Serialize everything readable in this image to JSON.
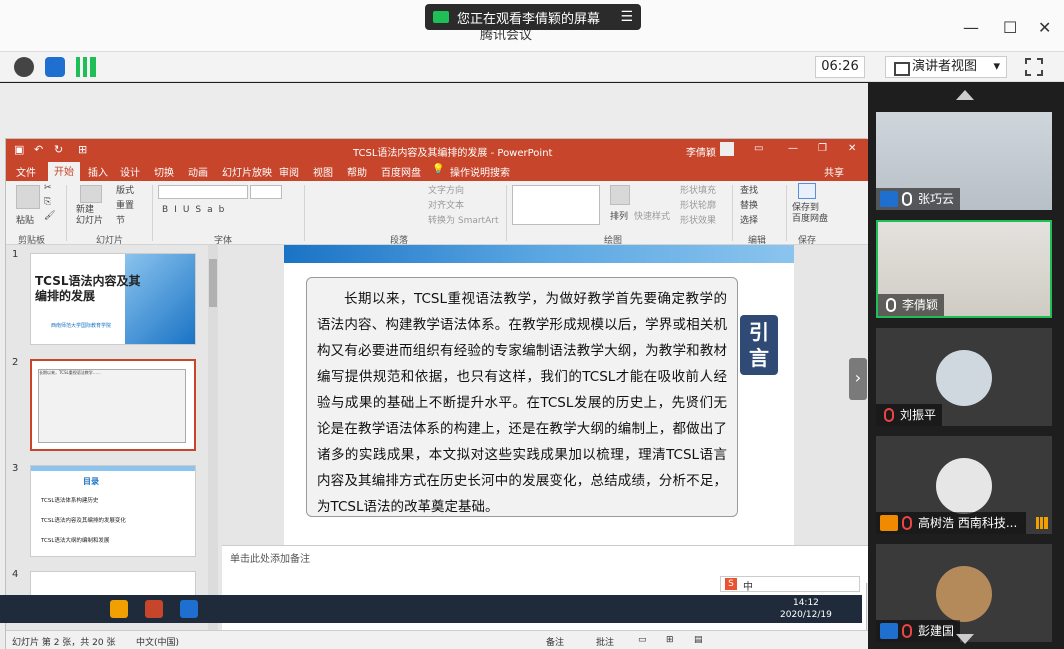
{
  "app": {
    "title": "腾讯会议",
    "share_banner": "您正在观看李倩颖的屏幕",
    "menu_icon": "menu-icon"
  },
  "toolbar": {
    "timer": "06:26",
    "view_mode": "演讲者视图"
  },
  "ppt": {
    "title": "TCSL语法内容及其编排的发展 - PowerPoint",
    "user": "李倩颖",
    "tabs": [
      "文件",
      "开始",
      "插入",
      "设计",
      "切换",
      "动画",
      "幻灯片放映",
      "审阅",
      "视图",
      "帮助",
      "百度网盘",
      "操作说明搜索"
    ],
    "active_tab": "开始",
    "share_label": "共享",
    "ribbon": {
      "paste": "粘贴",
      "clipboard": "剪贴板",
      "new_slide": "新建\n幻灯片",
      "layout": "版式",
      "reset": "重置",
      "section": "节",
      "slides_group": "幻灯片",
      "font_group": "字体",
      "text_direction": "文字方向",
      "align_text": "对齐文本",
      "smartart": "转换为 SmartArt",
      "paragraph_group": "段落",
      "arrange": "排列",
      "quick_styles": "快速样式",
      "shape_fill": "形状填充",
      "shape_outline": "形状轮廓",
      "shape_effects": "形状效果",
      "drawing_group": "绘图",
      "find": "查找",
      "replace": "替换",
      "select": "选择",
      "editing_group": "编辑",
      "save_baidu": "保存到\n百度网盘",
      "save_group": "保存"
    },
    "thumbnails": [
      {
        "num": "1",
        "title": "TCSL语法内容及其编排的发展",
        "sub": "西南师范大学国际教育学院"
      },
      {
        "num": "2",
        "title": "长期以来，TCSL重视语法教学……"
      },
      {
        "num": "3",
        "title": "目录",
        "items": [
          "TCSL语法体系构建历史",
          "TCSL语法内容及其编排的发展变化",
          "TCSL语法大纲的编制和发展"
        ]
      },
      {
        "num": "4"
      }
    ],
    "slide": {
      "body": "长期以来，TCSL重视语法教学，为做好教学首先要确定教学的语法内容、构建教学语法体系。在教学形成规模以后，学界或相关机构又有必要进而组织有经验的专家编制语法教学大纲，为教学和教材编写提供规范和依据，也只有这样，我们的TCSL才能在吸收前人经验与成果的基础上不断提升水平。在TCSL发展的历史上，先贤们无论是在教学语法体系的构建上，还是在教学大纲的编制上，都做出了诸多的实践成果，本文拟对这些实践成果加以梳理，理清TCSL语言内容及其编排方式在历史长河中的发展变化，总结成绩，分析不足，为TCSL语法的改革奠定基础。",
      "badge": "引\n言"
    },
    "notes_placeholder": "单击此处添加备注",
    "status": {
      "slide_info": "幻灯片 第 2 张，共 20 张",
      "language": "中文(中国)",
      "notes": "备注",
      "comments": "批注"
    }
  },
  "taskbar": {
    "time": "14:12",
    "date": "2020/12/19"
  },
  "ime": {
    "label": "中"
  },
  "participants": [
    {
      "name": "张巧云",
      "mic": "on",
      "badge": "user"
    },
    {
      "name": "李倩颖",
      "mic": "on",
      "badge": "none",
      "active": true
    },
    {
      "name": "刘振平",
      "mic": "muted",
      "badge": "none"
    },
    {
      "name": "高树浩 西南科技...",
      "mic": "muted",
      "badge": "orange"
    },
    {
      "name": "彭建国",
      "mic": "muted",
      "badge": "user"
    }
  ],
  "colors": {
    "ppt_red": "#c6452b",
    "active_green": "#1fbe57",
    "slide_blue": "#1a73c5"
  }
}
